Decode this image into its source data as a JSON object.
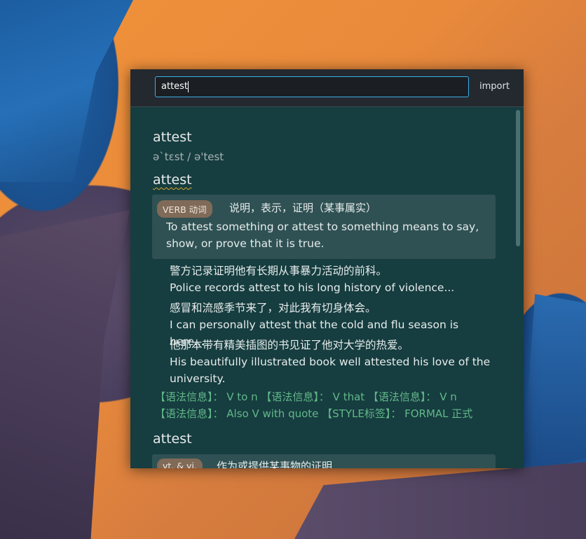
{
  "search": {
    "value": "attest"
  },
  "toolbar": {
    "import_label": "import"
  },
  "entry1": {
    "headword": "attest",
    "phonetic": "ə`tɛst / ə'test"
  },
  "entry2": {
    "headword": "attest",
    "sense": {
      "pos": "VERB 动词",
      "gloss": "说明，表示，证明（某事属实）",
      "definition": "To attest something or attest to something means to say, show, or prove that it is true."
    },
    "examples": [
      {
        "cn": "警方记录证明他有长期从事暴力活动的前科。",
        "en": "Police records attest to his long history of violence..."
      },
      {
        "cn": "感冒和流感季节来了，对此我有切身体会。",
        "en": "I can personally attest that the cold and flu season is here..."
      },
      {
        "cn": "他那本带有精美插图的书见证了他对大学的热爱。",
        "en": "His beautifully illustrated book well attested his love of the university."
      }
    ],
    "grammar": [
      "【语法信息】： V to n 【语法信息】： V that 【语法信息】： V n",
      "【语法信息】： Also V with quote 【STYLE标签】： FORMAL 正式"
    ]
  },
  "entry3": {
    "headword": "attest",
    "sense": {
      "pos": "vt. & vi.",
      "gloss": "作为或提供某事物的证明"
    }
  },
  "colors": {
    "panel": "#163d3f",
    "sense_bg": "#2f5153",
    "accent": "#3daee9",
    "grammar": "#62b88a",
    "badge": "#806a58"
  }
}
